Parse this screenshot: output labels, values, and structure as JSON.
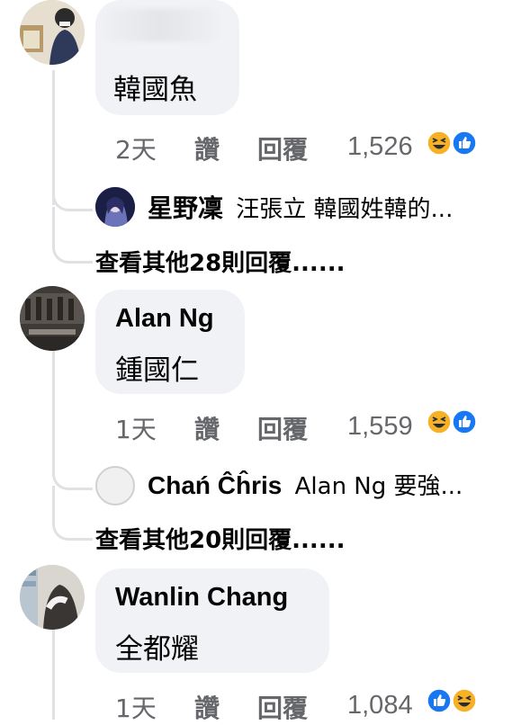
{
  "comments": [
    {
      "author": "",
      "text": "韓國魚",
      "time": "2天",
      "like_label": "讚",
      "reply_label": "回覆",
      "reaction_count": "1,526",
      "reply_preview": {
        "name": "星野凜",
        "text": "汪張立 韓國姓韓的..."
      },
      "more_replies": "查看其他28則回覆......"
    },
    {
      "author": "Alan Ng",
      "text": "鍾國仁",
      "time": "1天",
      "like_label": "讚",
      "reply_label": "回覆",
      "reaction_count": "1,559",
      "reply_preview": {
        "name": "Chań Ĉĥris",
        "text": "Alan Ng 要強..."
      },
      "more_replies": "查看其他20則回覆......"
    },
    {
      "author": "Wanlin Chang",
      "text": "全都耀",
      "time": "1天",
      "like_label": "讚",
      "reply_label": "回覆",
      "reaction_count": "1,084"
    }
  ],
  "icons": {
    "haha": "haha-reaction-icon",
    "like": "like-reaction-icon"
  },
  "colors": {
    "bubble": "#f0f2f5",
    "meta_text": "#65676b",
    "like_blue": "#1877f2",
    "haha_yellow": "#f7b125"
  }
}
